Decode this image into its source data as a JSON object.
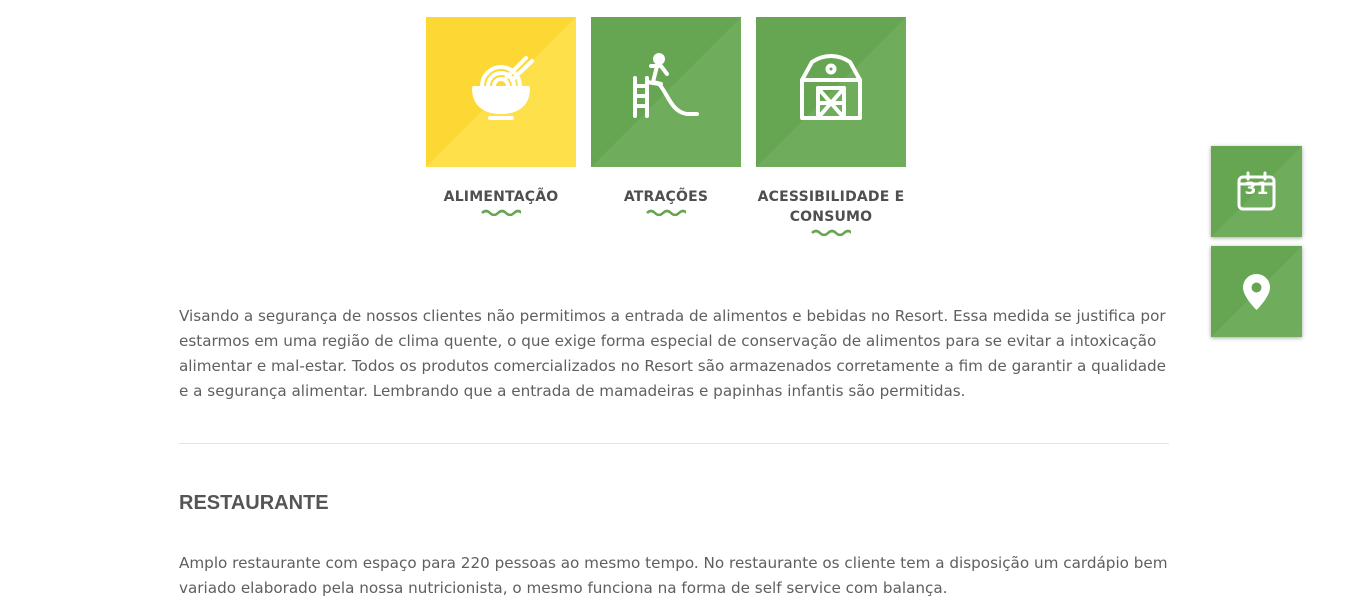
{
  "colors": {
    "yellow_tile": "#fdd835",
    "green_tile": "#66a552",
    "wave": "#66a552",
    "text": "#5f5f5f"
  },
  "categories": [
    {
      "label": "ALIMENTAÇÃO",
      "icon": "noodle-bowl-icon"
    },
    {
      "label": "ATRAÇÕES",
      "icon": "playground-slide-icon"
    },
    {
      "label": "ACESSIBILIDADE E CONSUMO",
      "icon": "barn-icon"
    }
  ],
  "intro": {
    "text": "Visando a segurança de nossos clientes não permitimos a entrada de alimentos e bebidas no Resort. Essa medida se justifica por estarmos em uma região de clima quente, o que exige forma especial de conservação de alimentos para se evitar a intoxicação alimentar e mal-estar. Todos os produtos comercializados no Resort são armazenados corretamente a fim de garantir a qualidade e a segurança alimentar. Lembrando que a entrada de mamadeiras e papinhas infantis são permitidas."
  },
  "restaurant": {
    "title": "RESTAURANTE",
    "text": "Amplo restaurante com espaço para 220 pessoas ao mesmo tempo. No restaurante os cliente tem a disposição um cardápio bem variado elaborado pela nossa nutricionista, o mesmo funciona na forma de self service com balança."
  },
  "floating_buttons": {
    "calendar_icon": "calendar-icon",
    "calendar_day": "31",
    "location_icon": "map-pin-icon"
  }
}
